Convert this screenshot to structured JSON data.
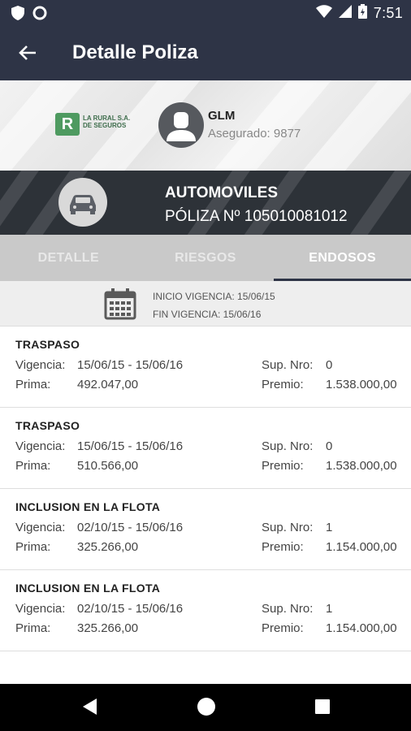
{
  "status_bar": {
    "time": "7:51",
    "left_icons": [
      "shield-icon",
      "circle-icon"
    ],
    "right_icons": [
      "wifi-icon",
      "signal-icon",
      "battery-icon"
    ]
  },
  "app_bar": {
    "title": "Detalle Poliza",
    "back_icon": "arrow-left-icon"
  },
  "header": {
    "logo_text_line1": "LA RURAL S.A.",
    "logo_text_line2": "DE SEGUROS",
    "logo_mark": "R",
    "user_name": "GLM",
    "user_subtitle": "Asegurado: 9877"
  },
  "policy": {
    "type": "AUTOMOVILES",
    "number": "PÓLIZA Nº 105010081012",
    "icon": "car-icon"
  },
  "tabs": [
    {
      "label": "DETALLE",
      "active": false
    },
    {
      "label": "RIESGOS",
      "active": false
    },
    {
      "label": "ENDOSOS",
      "active": true
    }
  ],
  "vigencia": {
    "inicio": "INICIO VIGENCIA: 15/06/15",
    "fin": "FIN VIGENCIA: 15/06/16"
  },
  "labels": {
    "vigencia": "Vigencia:",
    "prima": "Prima:",
    "sup_nro": "Sup. Nro:",
    "premio": "Premio:"
  },
  "endosos": [
    {
      "title": "TRASPASO",
      "vigencia": "15/06/15 - 15/06/16",
      "prima": "492.047,00",
      "sup_nro": "0",
      "premio": "1.538.000,00"
    },
    {
      "title": "TRASPASO",
      "vigencia": "15/06/15 - 15/06/16",
      "prima": "510.566,00",
      "sup_nro": "0",
      "premio": "1.538.000,00"
    },
    {
      "title": "INCLUSION EN LA FLOTA",
      "vigencia": "02/10/15 - 15/06/16",
      "prima": "325.266,00",
      "sup_nro": "1",
      "premio": "1.154.000,00"
    },
    {
      "title": "INCLUSION EN LA FLOTA",
      "vigencia": "02/10/15 - 15/06/16",
      "prima": "325.266,00",
      "sup_nro": "1",
      "premio": "1.154.000,00"
    }
  ],
  "colors": {
    "primary": "#2e3446",
    "tab_bg": "#c9c9c9",
    "logo_green": "#4e9a60"
  }
}
